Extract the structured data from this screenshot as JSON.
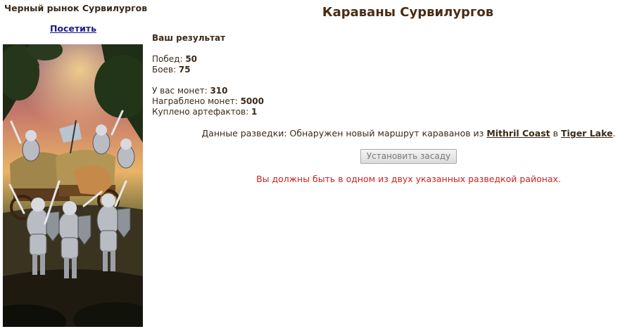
{
  "sidebar": {
    "title": "Черный рынок Сурвилургов",
    "visit_link": "Посетить"
  },
  "main": {
    "title": "Караваны Сурвилургов",
    "result_heading": "Ваш результат",
    "stats": [
      {
        "label": "Побед: ",
        "value": "50"
      },
      {
        "label": "Боев: ",
        "value": "75"
      }
    ],
    "coins": [
      {
        "label": "У вас монет: ",
        "value": "310"
      },
      {
        "label": "Награблено монет: ",
        "value": "5000"
      },
      {
        "label": "Куплено артефактов: ",
        "value": "1"
      }
    ],
    "intel": {
      "prefix": "Данные разведки: Обнаружен новый маршрут караванов из ",
      "from": "Mithril Coast",
      "middle": " в ",
      "to": "Tiger Lake",
      "suffix": "."
    },
    "ambush_button": "Установить засаду",
    "error": "Вы должны быть в одном из двух указанных разведкой районах."
  },
  "colors": {
    "title": "#4a2c14",
    "text": "#3b2a1a",
    "link": "#1a1a8f",
    "error": "#d02020"
  }
}
